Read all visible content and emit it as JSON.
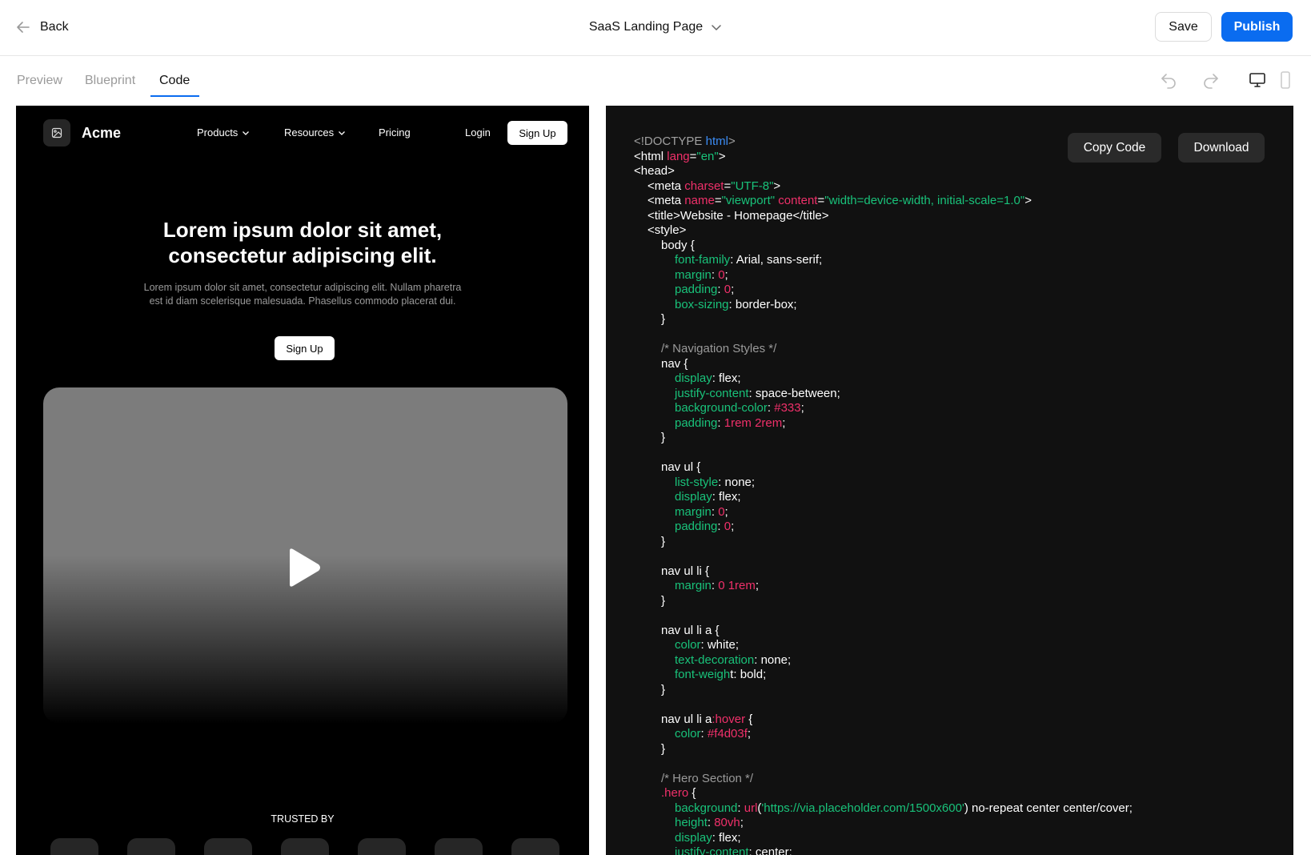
{
  "topbar": {
    "back_label": "Back",
    "project_title": "SaaS Landing Page",
    "save_label": "Save",
    "publish_label": "Publish"
  },
  "tabs": [
    {
      "label": "Preview",
      "active": false
    },
    {
      "label": "Blueprint",
      "active": false
    },
    {
      "label": "Code",
      "active": true
    }
  ],
  "preview": {
    "brand": "Acme",
    "nav": {
      "products": "Products",
      "resources": "Resources",
      "pricing": "Pricing",
      "login": "Login",
      "signup": "Sign Up"
    },
    "hero": {
      "heading_line1": "Lorem ipsum dolor sit amet,",
      "heading_line2": "consectetur adipiscing elit.",
      "paragraph_line1": "Lorem ipsum dolor sit amet, consectetur adipiscing elit. Nullam pharetra",
      "paragraph_line2": "est id diam scelerisque malesuada. Phasellus commodo placerat dui.",
      "cta": "Sign Up"
    },
    "trusted_label": "TRUSTED BY"
  },
  "code_panel": {
    "copy_label": "Copy Code",
    "download_label": "Download",
    "colors": {
      "tag": "#a0a0a0",
      "keyword": "#3b8cf5",
      "attr": "#f0306a",
      "string": "#19c27a",
      "prop": "#19c27a",
      "value": "#f0306a",
      "comment": "#9a9a9a",
      "plain": "#ffffff"
    },
    "lines": [
      {
        "indent": 0,
        "parts": [
          {
            "t": "<!DOCTYPE ",
            "c": "tag"
          },
          {
            "t": "html",
            "c": "keyword"
          },
          {
            "t": ">",
            "c": "tag"
          }
        ]
      },
      {
        "indent": 0,
        "parts": [
          {
            "t": "<html ",
            "c": "plain"
          },
          {
            "t": "lang",
            "c": "attr"
          },
          {
            "t": "=",
            "c": "plain"
          },
          {
            "t": "\"en\"",
            "c": "string"
          },
          {
            "t": ">",
            "c": "plain"
          }
        ]
      },
      {
        "indent": 0,
        "parts": [
          {
            "t": "<head>",
            "c": "plain"
          }
        ]
      },
      {
        "indent": 1,
        "parts": [
          {
            "t": "<meta ",
            "c": "plain"
          },
          {
            "t": "charset",
            "c": "attr"
          },
          {
            "t": "=",
            "c": "plain"
          },
          {
            "t": "\"UTF-8\"",
            "c": "string"
          },
          {
            "t": ">",
            "c": "plain"
          }
        ]
      },
      {
        "indent": 1,
        "parts": [
          {
            "t": "<meta ",
            "c": "plain"
          },
          {
            "t": "name",
            "c": "attr"
          },
          {
            "t": "=",
            "c": "plain"
          },
          {
            "t": "\"viewport\"",
            "c": "string"
          },
          {
            "t": " ",
            "c": "plain"
          },
          {
            "t": "content",
            "c": "attr"
          },
          {
            "t": "=",
            "c": "plain"
          },
          {
            "t": "\"width=device-width, initial-scale=1.0\"",
            "c": "string"
          },
          {
            "t": ">",
            "c": "plain"
          }
        ]
      },
      {
        "indent": 1,
        "parts": [
          {
            "t": "<title>Website - Homepage</title>",
            "c": "plain"
          }
        ]
      },
      {
        "indent": 1,
        "parts": [
          {
            "t": "<style>",
            "c": "plain"
          }
        ]
      },
      {
        "indent": 2,
        "parts": [
          {
            "t": "body {",
            "c": "plain"
          }
        ]
      },
      {
        "indent": 3,
        "parts": [
          {
            "t": "font-family",
            "c": "prop"
          },
          {
            "t": ": Arial, sans-serif;",
            "c": "plain"
          }
        ]
      },
      {
        "indent": 3,
        "parts": [
          {
            "t": "margin",
            "c": "prop"
          },
          {
            "t": ": ",
            "c": "plain"
          },
          {
            "t": "0",
            "c": "value"
          },
          {
            "t": ";",
            "c": "plain"
          }
        ]
      },
      {
        "indent": 3,
        "parts": [
          {
            "t": "padding",
            "c": "prop"
          },
          {
            "t": ": ",
            "c": "plain"
          },
          {
            "t": "0",
            "c": "value"
          },
          {
            "t": ";",
            "c": "plain"
          }
        ]
      },
      {
        "indent": 3,
        "parts": [
          {
            "t": "box-sizing",
            "c": "prop"
          },
          {
            "t": ": border-box;",
            "c": "plain"
          }
        ]
      },
      {
        "indent": 2,
        "parts": [
          {
            "t": "}",
            "c": "plain"
          }
        ]
      },
      {
        "indent": 0,
        "parts": []
      },
      {
        "indent": 2,
        "parts": [
          {
            "t": "/* Navigation Styles */",
            "c": "comment"
          }
        ]
      },
      {
        "indent": 2,
        "parts": [
          {
            "t": "nav {",
            "c": "plain"
          }
        ]
      },
      {
        "indent": 3,
        "parts": [
          {
            "t": "display",
            "c": "prop"
          },
          {
            "t": ": flex;",
            "c": "plain"
          }
        ]
      },
      {
        "indent": 3,
        "parts": [
          {
            "t": "justify-content",
            "c": "prop"
          },
          {
            "t": ": space-between;",
            "c": "plain"
          }
        ]
      },
      {
        "indent": 3,
        "parts": [
          {
            "t": "background-color",
            "c": "prop"
          },
          {
            "t": ": ",
            "c": "plain"
          },
          {
            "t": "#333",
            "c": "value"
          },
          {
            "t": ";",
            "c": "plain"
          }
        ]
      },
      {
        "indent": 3,
        "parts": [
          {
            "t": "padding",
            "c": "prop"
          },
          {
            "t": ": ",
            "c": "plain"
          },
          {
            "t": "1rem 2rem",
            "c": "value"
          },
          {
            "t": ";",
            "c": "plain"
          }
        ]
      },
      {
        "indent": 2,
        "parts": [
          {
            "t": "}",
            "c": "plain"
          }
        ]
      },
      {
        "indent": 0,
        "parts": []
      },
      {
        "indent": 2,
        "parts": [
          {
            "t": "nav ul {",
            "c": "plain"
          }
        ]
      },
      {
        "indent": 3,
        "parts": [
          {
            "t": "list-style",
            "c": "prop"
          },
          {
            "t": ": none;",
            "c": "plain"
          }
        ]
      },
      {
        "indent": 3,
        "parts": [
          {
            "t": "display",
            "c": "prop"
          },
          {
            "t": ": flex;",
            "c": "plain"
          }
        ]
      },
      {
        "indent": 3,
        "parts": [
          {
            "t": "margin",
            "c": "prop"
          },
          {
            "t": ": ",
            "c": "plain"
          },
          {
            "t": "0",
            "c": "value"
          },
          {
            "t": ";",
            "c": "plain"
          }
        ]
      },
      {
        "indent": 3,
        "parts": [
          {
            "t": "padding",
            "c": "prop"
          },
          {
            "t": ": ",
            "c": "plain"
          },
          {
            "t": "0",
            "c": "value"
          },
          {
            "t": ";",
            "c": "plain"
          }
        ]
      },
      {
        "indent": 2,
        "parts": [
          {
            "t": "}",
            "c": "plain"
          }
        ]
      },
      {
        "indent": 0,
        "parts": []
      },
      {
        "indent": 2,
        "parts": [
          {
            "t": "nav ul li {",
            "c": "plain"
          }
        ]
      },
      {
        "indent": 3,
        "parts": [
          {
            "t": "margin",
            "c": "prop"
          },
          {
            "t": ": ",
            "c": "plain"
          },
          {
            "t": "0 1rem",
            "c": "value"
          },
          {
            "t": ";",
            "c": "plain"
          }
        ]
      },
      {
        "indent": 2,
        "parts": [
          {
            "t": "}",
            "c": "plain"
          }
        ]
      },
      {
        "indent": 0,
        "parts": []
      },
      {
        "indent": 2,
        "parts": [
          {
            "t": "nav ul li a {",
            "c": "plain"
          }
        ]
      },
      {
        "indent": 3,
        "parts": [
          {
            "t": "color",
            "c": "prop"
          },
          {
            "t": ": white;",
            "c": "plain"
          }
        ]
      },
      {
        "indent": 3,
        "parts": [
          {
            "t": "text-decoration",
            "c": "prop"
          },
          {
            "t": ": none;",
            "c": "plain"
          }
        ]
      },
      {
        "indent": 3,
        "parts": [
          {
            "t": "font-weigh",
            "c": "prop"
          },
          {
            "t": "t: bold;",
            "c": "plain"
          }
        ]
      },
      {
        "indent": 2,
        "parts": [
          {
            "t": "}",
            "c": "plain"
          }
        ]
      },
      {
        "indent": 0,
        "parts": []
      },
      {
        "indent": 2,
        "parts": [
          {
            "t": "nav ul li a",
            "c": "plain"
          },
          {
            "t": ":hover",
            "c": "attr"
          },
          {
            "t": " {",
            "c": "plain"
          }
        ]
      },
      {
        "indent": 3,
        "parts": [
          {
            "t": "color",
            "c": "prop"
          },
          {
            "t": ": ",
            "c": "plain"
          },
          {
            "t": "#f4d03f",
            "c": "value"
          },
          {
            "t": ";",
            "c": "plain"
          }
        ]
      },
      {
        "indent": 2,
        "parts": [
          {
            "t": "}",
            "c": "plain"
          }
        ]
      },
      {
        "indent": 0,
        "parts": []
      },
      {
        "indent": 2,
        "parts": [
          {
            "t": "/* Hero Section */",
            "c": "comment"
          }
        ]
      },
      {
        "indent": 2,
        "parts": [
          {
            "t": ".hero",
            "c": "attr"
          },
          {
            "t": " {",
            "c": "plain"
          }
        ]
      },
      {
        "indent": 3,
        "parts": [
          {
            "t": "background",
            "c": "prop"
          },
          {
            "t": ": ",
            "c": "plain"
          },
          {
            "t": "url",
            "c": "value"
          },
          {
            "t": "(",
            "c": "plain"
          },
          {
            "t": "'https://via.placeholder.com/1500x600'",
            "c": "string"
          },
          {
            "t": ") no-repeat center center/cover;",
            "c": "plain"
          }
        ]
      },
      {
        "indent": 3,
        "parts": [
          {
            "t": "height",
            "c": "prop"
          },
          {
            "t": ": ",
            "c": "plain"
          },
          {
            "t": "80vh",
            "c": "value"
          },
          {
            "t": ";",
            "c": "plain"
          }
        ]
      },
      {
        "indent": 3,
        "parts": [
          {
            "t": "display",
            "c": "prop"
          },
          {
            "t": ": flex;",
            "c": "plain"
          }
        ]
      },
      {
        "indent": 3,
        "parts": [
          {
            "t": "justify-content",
            "c": "prop"
          },
          {
            "t": ": center;",
            "c": "plain"
          }
        ]
      }
    ]
  }
}
